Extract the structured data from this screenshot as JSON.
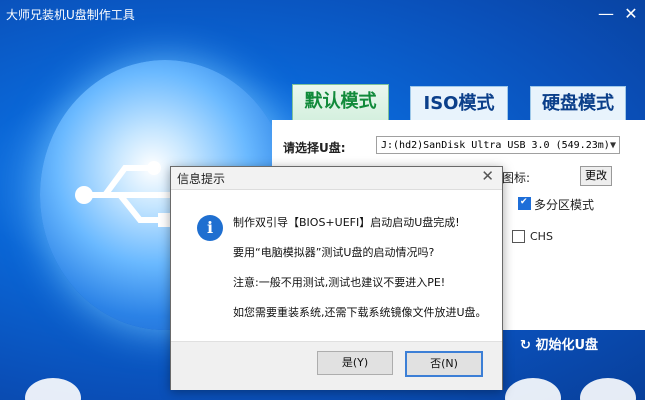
{
  "window": {
    "title": "大师兄装机U盘制作工具",
    "min_glyph": "—",
    "close_glyph": "✕"
  },
  "tabs": [
    {
      "label": "默认模式",
      "active": true
    },
    {
      "label": "ISO模式",
      "active": false
    },
    {
      "label": "硬盘模式",
      "active": false
    }
  ],
  "form": {
    "select_label": "请选择U盘:",
    "disk_value": "J:(hd2)SanDisk Ultra USB 3.0 (549.23m)",
    "icon_label": "图标:",
    "change_button": "更改",
    "multipartition_label": "多分区模式",
    "multipartition_checked": true,
    "chs_label": "CHS",
    "chs_checked": false
  },
  "init_button": "初始化U盘",
  "dialog": {
    "title": "信息提示",
    "close_glyph": "✕",
    "icon": "info-icon",
    "lines": [
      "制作双引导【BIOS+UEFI】启动启动U盘完成!",
      "要用“电脑模拟器”测试U盘的启动情况吗?",
      "注意:一般不用测试,测试也建议不要进入PE!",
      "如您需要重装系统,还需下载系统镜像文件放进U盘。"
    ],
    "yes_button": "是(Y)",
    "no_button": "否(N)"
  },
  "colors": {
    "accent": "#0a66d6",
    "active_tab": "#118a3a",
    "info_icon": "#1f6fd0"
  }
}
